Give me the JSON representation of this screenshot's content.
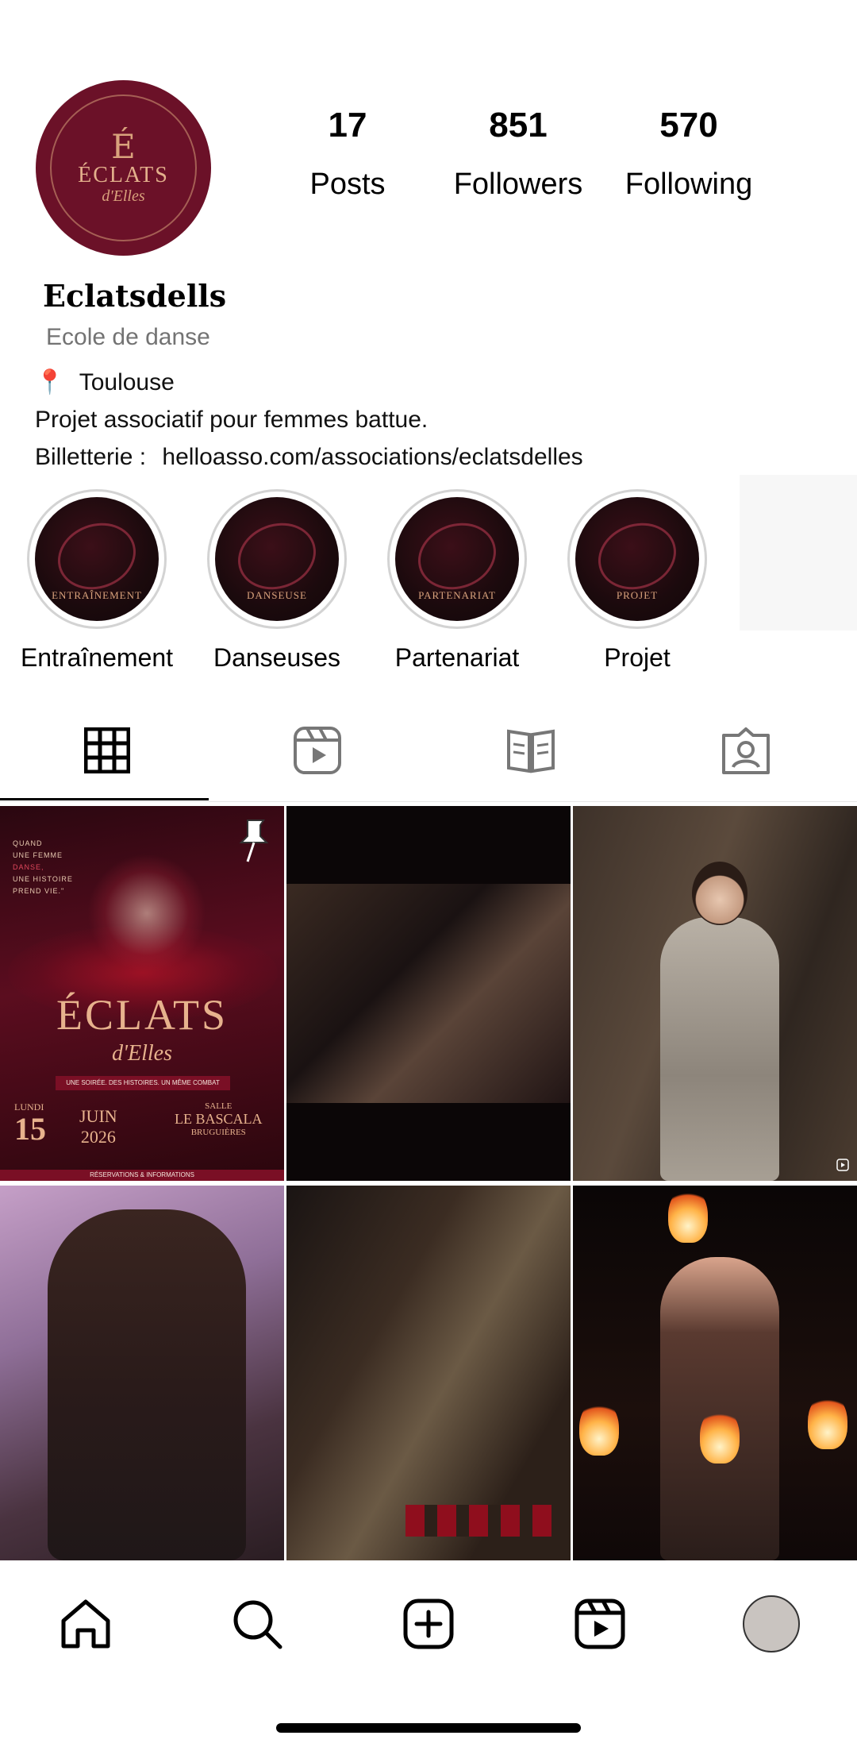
{
  "profile": {
    "logo_letter": "É",
    "logo_word": "ÉCLATS",
    "logo_sub": "d'Elles",
    "username": "Eclatsdells",
    "category": "Ecole de danse",
    "location_icon": "📍",
    "location": "Toulouse",
    "bio": "Projet associatif pour femmes battue.",
    "link_prefix": "Billetterie :",
    "link": "helloasso.com/associations/eclatsdelles"
  },
  "stats": [
    {
      "value": "17",
      "label": "Posts"
    },
    {
      "value": "851",
      "label": "Followers"
    },
    {
      "value": "570",
      "label": "Following"
    }
  ],
  "highlights": [
    {
      "label": "Entraînement",
      "tag": "ENTRAÎNEMENT"
    },
    {
      "label": "Danseuses",
      "tag": "DANSEUSE"
    },
    {
      "label": "Partenariat",
      "tag": "PARTENARIAT"
    },
    {
      "label": "Projet",
      "tag": "PROJET"
    }
  ],
  "tabs": [
    {
      "name": "grid-icon",
      "active": true
    },
    {
      "name": "reels-icon",
      "active": false
    },
    {
      "name": "guide-icon",
      "active": false
    },
    {
      "name": "tagged-icon",
      "active": false
    }
  ],
  "poster": {
    "quote_1": "QUAND",
    "quote_2": "UNE FEMME",
    "quote_3": "DANSE,",
    "quote_4": "UNE HISTOIRE",
    "quote_5": "PREND VIE.\"",
    "title": "ÉCLATS",
    "title_sub": "d'Elles",
    "band": "UNE SOIRÉE. DES HISTOIRES. UN MÊME COMBAT",
    "day_name": "LUNDI",
    "day_num": "15",
    "month": "JUIN",
    "year": "2026",
    "venue_label": "SALLE",
    "venue": "LE BASCALA",
    "city": "BRUGUIÈRES",
    "footer": "RÉSERVATIONS & INFORMATIONS"
  },
  "nav": [
    {
      "name": "home-icon"
    },
    {
      "name": "search-icon"
    },
    {
      "name": "create-icon"
    },
    {
      "name": "reels-nav-icon"
    },
    {
      "name": "profile-avatar"
    }
  ],
  "colors": {
    "brand": "#6b1128",
    "accent_gold": "#d9a27c",
    "text_secondary": "#737373"
  }
}
